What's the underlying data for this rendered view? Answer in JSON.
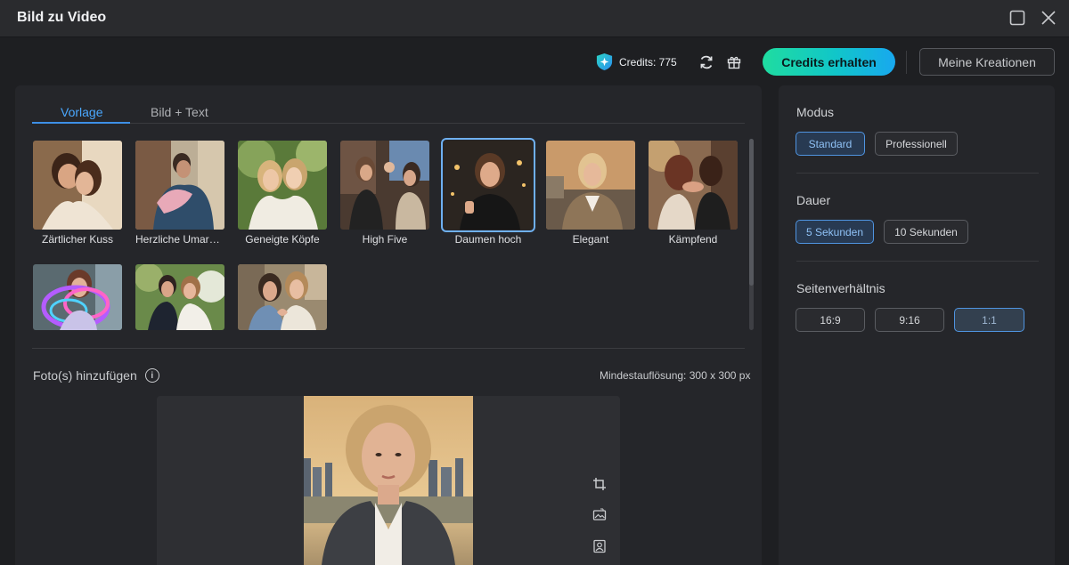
{
  "window": {
    "title": "Bild zu Video"
  },
  "topbar": {
    "credits_label": "Credits: 775",
    "get_credits_label": "Credits erhalten",
    "my_creations_label": "Meine Kreationen"
  },
  "tabs": [
    {
      "label": "Vorlage",
      "active": true
    },
    {
      "label": "Bild + Text",
      "active": false
    }
  ],
  "templates": [
    {
      "label": "Zärtlicher Kuss",
      "selected": false
    },
    {
      "label": "Herzliche Umarm...",
      "selected": false
    },
    {
      "label": "Geneigte Köpfe",
      "selected": false
    },
    {
      "label": "High Five",
      "selected": false
    },
    {
      "label": "Daumen hoch",
      "selected": true
    },
    {
      "label": "Elegant",
      "selected": false
    },
    {
      "label": "Kämpfend",
      "selected": false
    },
    {
      "label": "",
      "selected": false
    },
    {
      "label": "",
      "selected": false
    },
    {
      "label": "",
      "selected": false
    }
  ],
  "upload": {
    "label": "Foto(s) hinzufügen",
    "min_resolution": "Mindestauflösung: 300 x 300 px"
  },
  "settings": {
    "mode": {
      "title": "Modus",
      "options": [
        "Standard",
        "Professionell"
      ],
      "selected": "Standard"
    },
    "duration": {
      "title": "Dauer",
      "options": [
        "5 Sekunden",
        "10 Sekunden"
      ],
      "selected": "5 Sekunden"
    },
    "aspect": {
      "title": "Seitenverhältnis",
      "options": [
        "16:9",
        "9:16",
        "1:1"
      ],
      "selected": "1:1"
    }
  },
  "colors": {
    "accent": "#4aa8ff",
    "cta_start": "#1fdca0",
    "cta_end": "#18a8ef",
    "background": "#1e1f22"
  }
}
